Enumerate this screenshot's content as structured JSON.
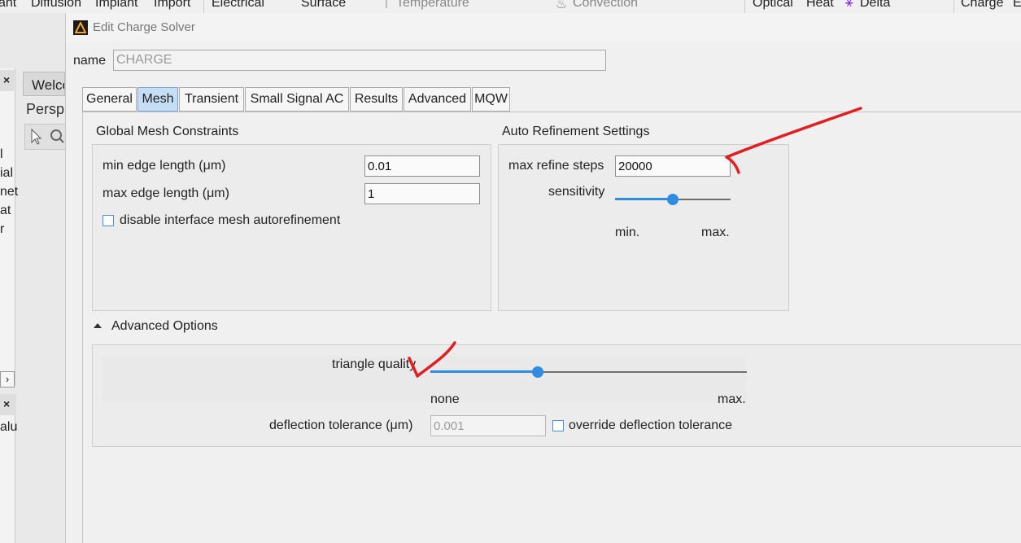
{
  "background": {
    "toolbar_items": [
      "ant",
      "Diffusion",
      "Implant",
      "Import",
      "Electrical",
      "Surface",
      "Temperature",
      "Convection",
      "Optical",
      "Heat",
      "Delta",
      "Charge",
      "E"
    ],
    "left_panel_letters": [
      "l",
      "ial",
      "net",
      "at",
      "r"
    ],
    "left_panel2_letters": "alu",
    "welcome_tab": "Welco",
    "perspective_label": "Persp"
  },
  "dialog": {
    "title": "Edit Charge Solver",
    "name_label": "name",
    "name_value": "CHARGE",
    "tabs": [
      {
        "label": "General",
        "active": false
      },
      {
        "label": "Mesh",
        "active": true
      },
      {
        "label": "Transient",
        "active": false
      },
      {
        "label": "Small Signal AC",
        "active": false
      },
      {
        "label": "Results",
        "active": false
      },
      {
        "label": "Advanced",
        "active": false
      },
      {
        "label": "MQW",
        "active": false
      }
    ],
    "global_mesh": {
      "title": "Global Mesh Constraints",
      "min_edge_label": "min edge length (μm)",
      "min_edge_value": "0.01",
      "max_edge_label": "max edge length (μm)",
      "max_edge_value": "1",
      "disable_autorefine_label": "disable interface mesh autorefinement",
      "disable_autorefine_checked": false
    },
    "auto_refinement": {
      "title": "Auto Refinement Settings",
      "max_refine_label": "max refine steps",
      "max_refine_value": "20000",
      "sensitivity_label": "sensitivity",
      "sensitivity_level": 0.5,
      "min_label": "min.",
      "max_label": "max."
    },
    "advanced_options": {
      "title": "Advanced Options",
      "expanded": true,
      "triangle_quality_label": "triangle quality",
      "triangle_quality_level": 0.34,
      "none_label": "none",
      "max_label": "max.",
      "deflection_label": "deflection tolerance (μm)",
      "deflection_value": "0.001",
      "override_label": "override deflection tolerance",
      "override_checked": false
    }
  },
  "colors": {
    "accent": "#2f8ce0",
    "active_tab": "#c5def5",
    "annotation": "#e02020"
  }
}
